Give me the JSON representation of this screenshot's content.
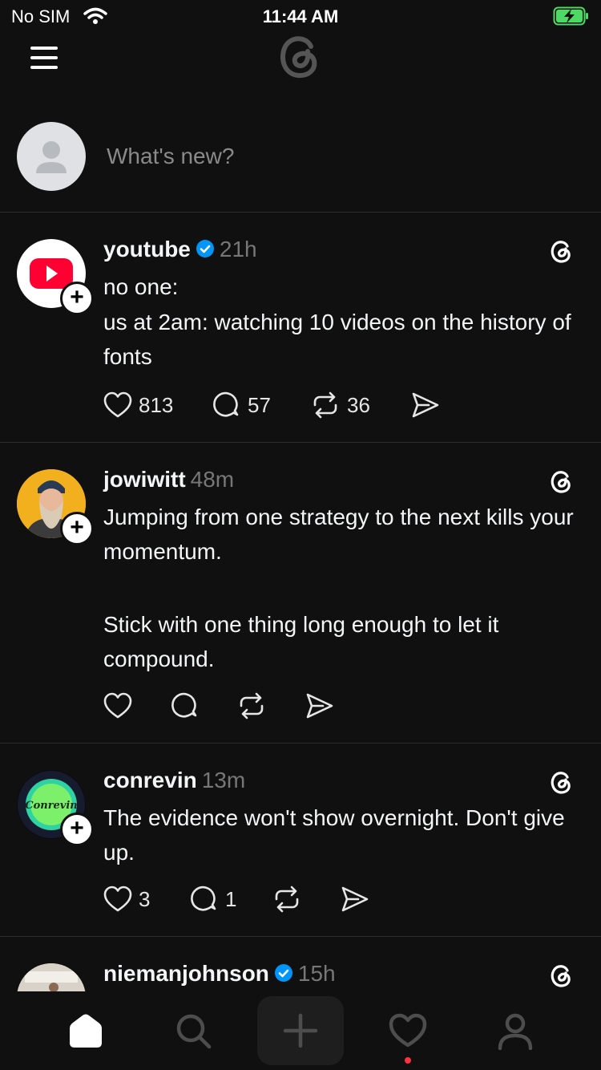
{
  "status_bar": {
    "carrier": "No SIM",
    "time": "11:44 AM",
    "battery_icon": "battery-charging-icon"
  },
  "header": {
    "menu_icon": "menu-icon",
    "logo": "threads-logo"
  },
  "composer": {
    "placeholder": "What's new?"
  },
  "posts": [
    {
      "username": "youtube",
      "verified": true,
      "time": "21h",
      "lines": [
        "no one:",
        "us at 2am: watching 10 videos on the history of fonts"
      ],
      "likes": "813",
      "replies": "57",
      "reposts": "36"
    },
    {
      "username": "jowiwitt",
      "verified": false,
      "time": "48m",
      "lines": [
        "Jumping from one strategy to the next kills your momentum.",
        "Stick with one thing long enough to let it compound."
      ],
      "likes": "",
      "replies": "",
      "reposts": ""
    },
    {
      "username": "conrevin",
      "verified": false,
      "time": "13m",
      "lines": [
        "The evidence won't show overnight. Don't give up."
      ],
      "likes": "3",
      "replies": "1",
      "reposts": "",
      "avatar_text": "Conrevin"
    },
    {
      "username": "niemanjohnson",
      "verified": true,
      "time": "15h",
      "lines": [],
      "likes": "",
      "replies": "",
      "reposts": ""
    }
  ],
  "tab_bar": {
    "tabs": [
      "home-icon",
      "search-icon",
      "create-icon",
      "activity-icon",
      "profile-icon"
    ],
    "notification_dot_color": "#ff3040"
  },
  "colors": {
    "background": "#101010",
    "verified": "#0095f6",
    "text": "#f3f5f7",
    "muted": "#777777"
  }
}
